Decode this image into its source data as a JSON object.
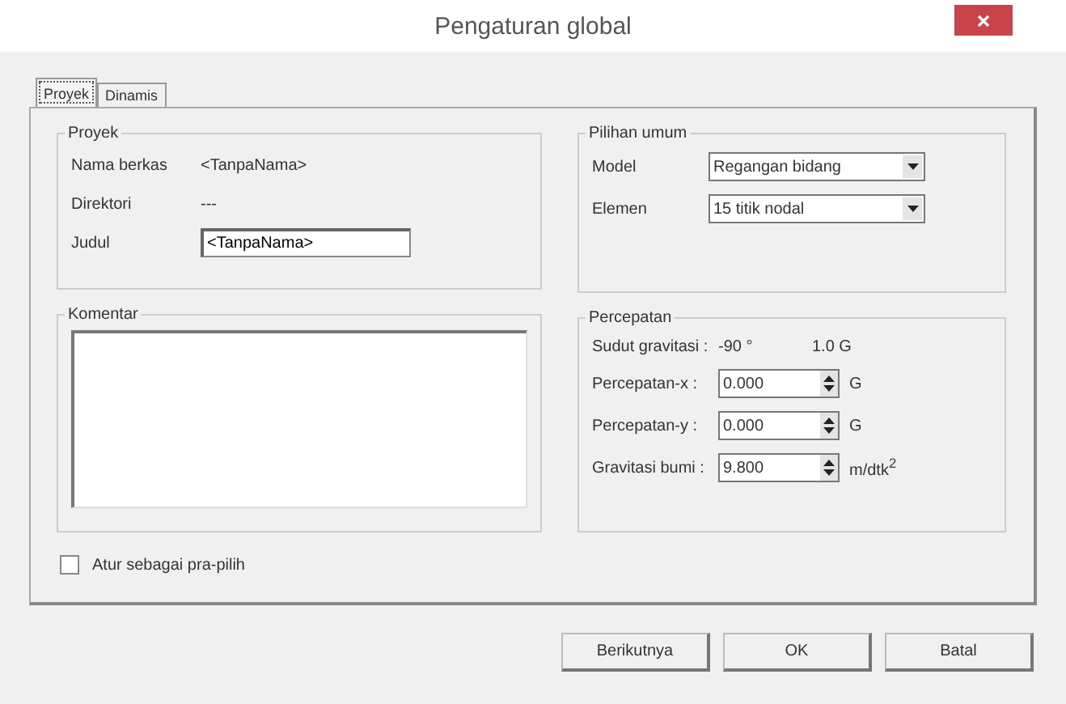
{
  "window": {
    "title": "Pengaturan global"
  },
  "tabs": [
    {
      "label": "Proyek",
      "selected": true
    },
    {
      "label": "Dinamis",
      "selected": false
    }
  ],
  "project": {
    "title": "Proyek",
    "rows": [
      {
        "kind": "text",
        "label": "Nama berkas",
        "value": "<TanpaNama>"
      },
      {
        "kind": "text",
        "label": "Direktori",
        "value": "---"
      },
      {
        "kind": "field",
        "label": "Judul",
        "value": "<TanpaNama>"
      }
    ]
  },
  "comment": {
    "title": "Komentar"
  },
  "default_checkbox": {
    "label": "Atur sebagai pra-pilih",
    "checked": false
  },
  "general": {
    "title": "Pilihan umum",
    "rows": [
      {
        "label": "Model",
        "value": "Regangan bidang"
      },
      {
        "label": "Elemen",
        "value": "15 titik nodal"
      }
    ]
  },
  "acceleration": {
    "title": "Percepatan",
    "rows": [
      {
        "kind": "text",
        "label": "Sudut gravitasi :",
        "value": "-90 °",
        "unit": "1.0 G"
      },
      {
        "kind": "spin",
        "label": "Percepatan-x :",
        "value": "0.000",
        "unit": "G"
      },
      {
        "kind": "spin",
        "label": "Percepatan-y :",
        "value": "0.000",
        "unit": "G"
      },
      {
        "kind": "spin",
        "label": "Gravitasi bumi :",
        "value": "9.800",
        "unit": "m/dtk$^{2}$"
      }
    ]
  },
  "buttons": [
    "Berikutnya",
    "OK",
    "Batal"
  ]
}
